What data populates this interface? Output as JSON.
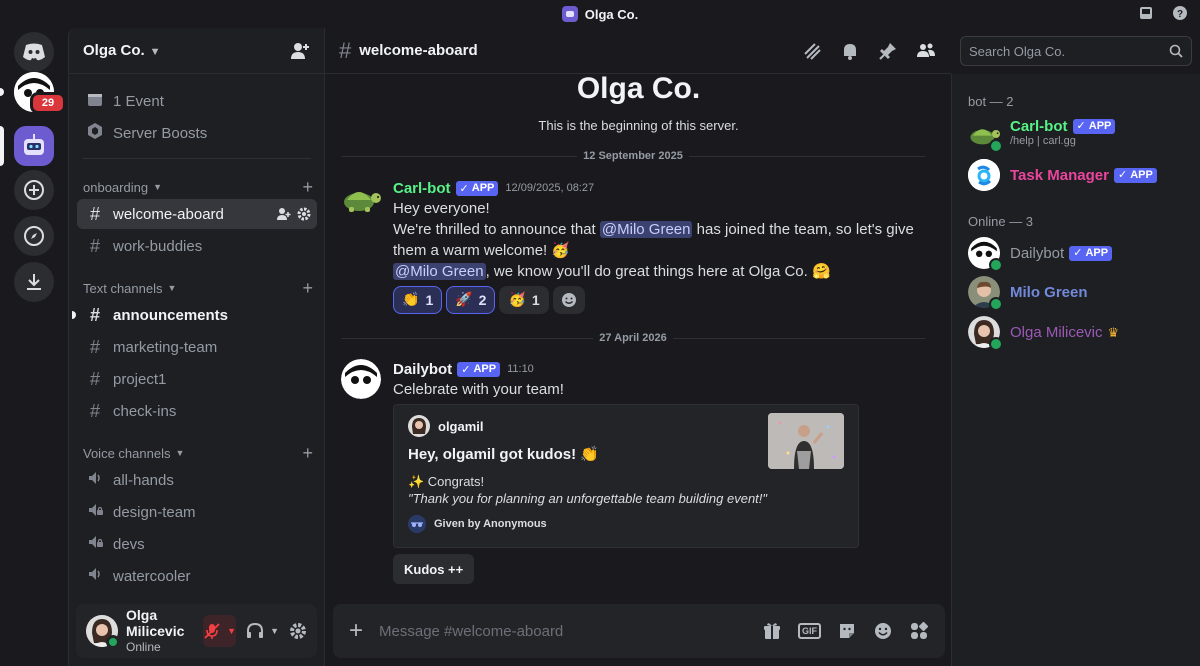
{
  "window": {
    "title": "Olga Co."
  },
  "rail": {
    "dm_badge": "29"
  },
  "server": {
    "name": "Olga Co."
  },
  "sidebar": {
    "top_items": [
      {
        "label": "1 Event"
      },
      {
        "label": "Server Boosts"
      }
    ],
    "categories": {
      "onboarding": "onboarding",
      "text": "Text channels",
      "voice": "Voice channels"
    },
    "onboarding_channels": [
      "welcome-aboard",
      "work-buddies"
    ],
    "text_channels": [
      "announcements",
      "marketing-team",
      "project1",
      "check-ins"
    ],
    "voice_channels": [
      "all-hands",
      "design-team",
      "devs",
      "watercooler"
    ]
  },
  "user": {
    "name": "Olga Milicevic",
    "status": "Online"
  },
  "chat": {
    "channel": "welcome-aboard",
    "welcome_title": "Olga Co.",
    "welcome_sub": "This is the beginning of this server.",
    "date1": "12 September 2025",
    "date2": "27 April 2026",
    "msg1": {
      "author": "Carl-bot",
      "tag": "APP",
      "ts": "12/09/2025, 08:27",
      "line1": "Hey everyone!",
      "line2a": "We're thrilled to announce that ",
      "mention1": "@Milo Green",
      "line2b": " has joined the team, so let's give",
      "line3": "them a warm welcome! ",
      "mention2": "@Milo Green",
      "line4": ", we know you'll do great things here at Olga Co. ",
      "reactions": [
        {
          "emoji": "👏",
          "count": "1"
        },
        {
          "emoji": "🚀",
          "count": "2"
        },
        {
          "emoji": "🥳",
          "count": "1"
        }
      ]
    },
    "msg2": {
      "author": "Dailybot",
      "tag": "APP",
      "ts": "11:10",
      "text": "Celebrate with your team!",
      "embed": {
        "author": "olgamil",
        "title": "Hey, olgamil got kudos! 👏",
        "line1": "✨ Congrats!",
        "line2": "\"Thank you for planning an unforgettable team building event!\"",
        "footer": "Given by Anonymous"
      },
      "button": "Kudos ++"
    },
    "composer_placeholder": "Message #welcome-aboard"
  },
  "search": {
    "placeholder": "Search Olga Co."
  },
  "members": {
    "group1": "bot — 2",
    "group2": "Online — 3",
    "list": [
      {
        "name": "Carl-bot",
        "tag": "APP",
        "sub": "/help | carl.gg",
        "color": "#57f287"
      },
      {
        "name": "Task Manager",
        "tag": "APP",
        "color": "#eb459e"
      },
      {
        "name": "Dailybot",
        "tag": "APP",
        "color": "#949ba4"
      },
      {
        "name": "Milo Green",
        "color": "#7289da"
      },
      {
        "name": "Olga Milicevic",
        "crown": "♛",
        "color": "#9b59b6"
      }
    ]
  },
  "colors": {
    "accent": "#5865f2",
    "online": "#23a55a",
    "danger": "#da373c"
  }
}
